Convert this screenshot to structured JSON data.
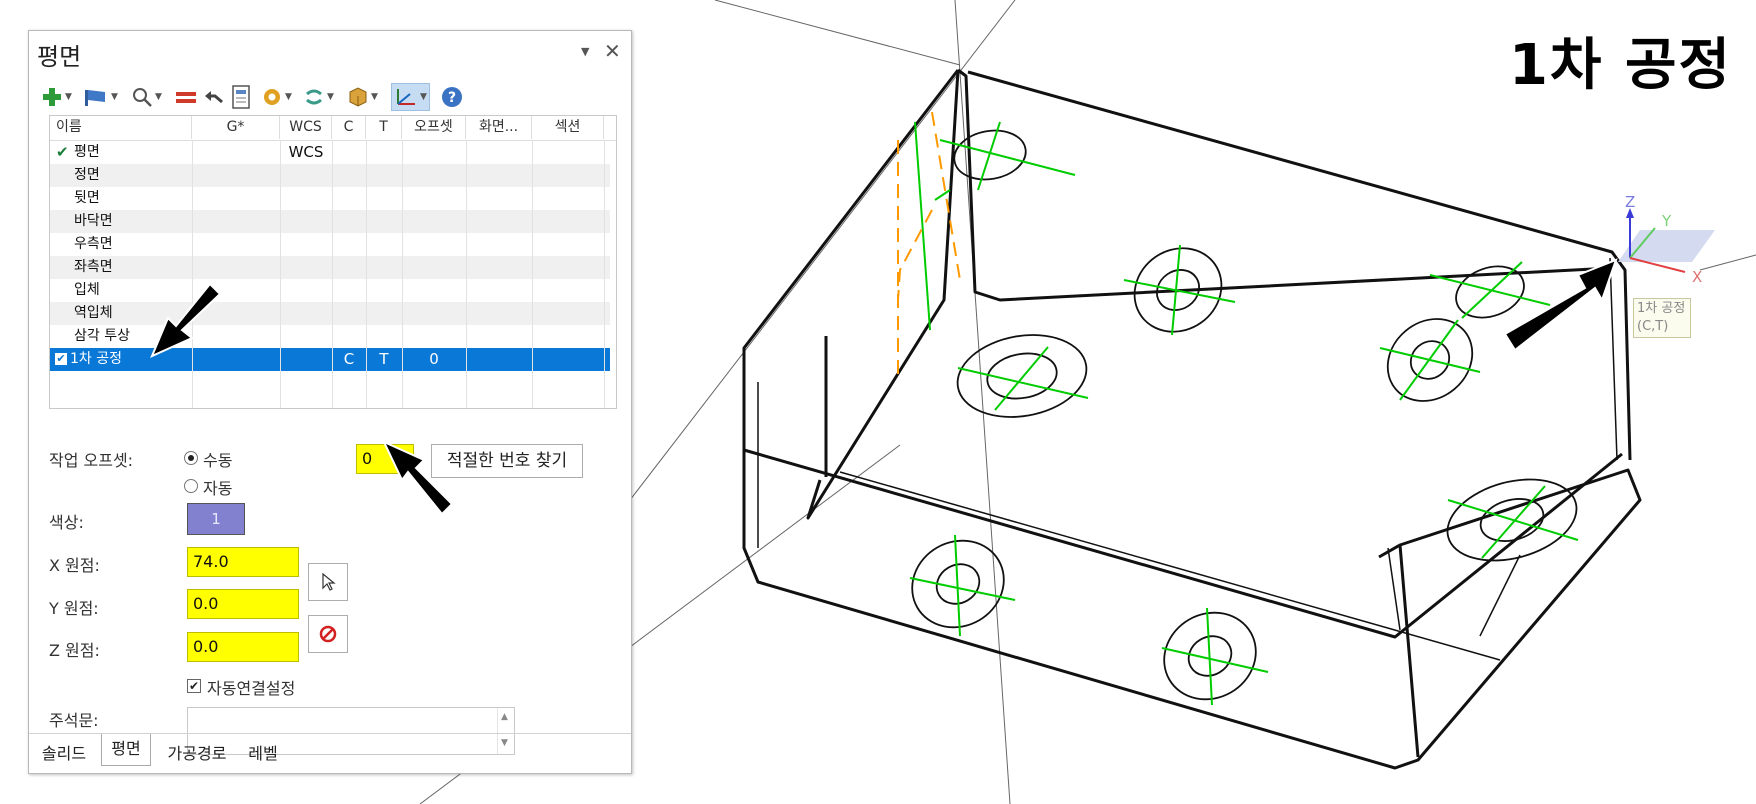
{
  "page_title": "1차 공정",
  "tooltip": {
    "line1": "1차 공정",
    "line2": "(C,T)"
  },
  "panel": {
    "title": "평면",
    "pin_icon": "▼",
    "close_icon": "✕",
    "columns": [
      "이름",
      "G*",
      "WCS",
      "C",
      "T",
      "오프셋",
      "화면...",
      "섹션"
    ],
    "rows": [
      {
        "name": "평면",
        "checked": true,
        "wcs": "WCS",
        "c": "",
        "t": "",
        "offset": ""
      },
      {
        "name": "정면",
        "wcs": "",
        "c": "",
        "t": "",
        "offset": ""
      },
      {
        "name": "뒷면",
        "wcs": "",
        "c": "",
        "t": "",
        "offset": ""
      },
      {
        "name": "바닥면",
        "wcs": "",
        "c": "",
        "t": "",
        "offset": ""
      },
      {
        "name": "우측면",
        "wcs": "",
        "c": "",
        "t": "",
        "offset": ""
      },
      {
        "name": "좌측면",
        "wcs": "",
        "c": "",
        "t": "",
        "offset": ""
      },
      {
        "name": "입체",
        "wcs": "",
        "c": "",
        "t": "",
        "offset": ""
      },
      {
        "name": "역입체",
        "wcs": "",
        "c": "",
        "t": "",
        "offset": ""
      },
      {
        "name": "삼각 투상",
        "wcs": "",
        "c": "",
        "t": "",
        "offset": ""
      },
      {
        "name": "1차 공정",
        "selected": true,
        "wcs": "",
        "c": "C",
        "t": "T",
        "offset": "0"
      }
    ],
    "work_offset_label": "작업 오프셋:",
    "manual_label": "수동",
    "auto_label": "자동",
    "offset_value": "0",
    "find_button": "적절한 번호 찾기",
    "color_label": "색상:",
    "color_value": "1",
    "color_hex": "#8181d0",
    "x_label": "X 원점:",
    "x_value": "74.0",
    "y_label": "Y 원점:",
    "y_value": "0.0",
    "z_label": "Z 원점:",
    "z_value": "0.0",
    "auto_link_label": "자동연결설정",
    "notes_label": "주석문:",
    "tabs": [
      "솔리드",
      "평면",
      "가공경로",
      "레벨"
    ]
  },
  "colors": {
    "selection": "#0a78d7",
    "highlight_input": "#ffff00",
    "hole_axis": "#00cc00",
    "hidden_line": "#ff9900"
  }
}
